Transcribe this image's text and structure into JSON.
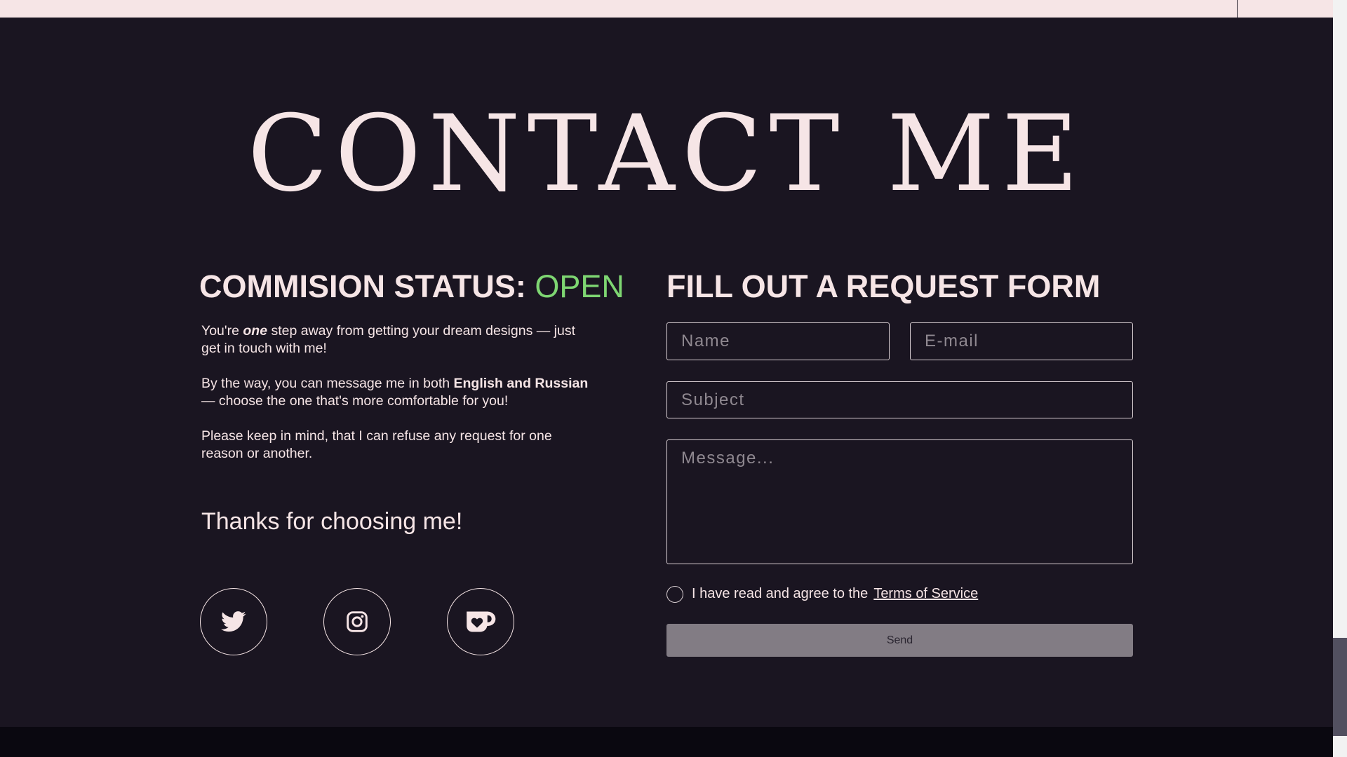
{
  "header": {
    "title": "CONTACT ME"
  },
  "status": {
    "label": "COMMISION STATUS:",
    "value": "OPEN",
    "value_color": "#7ed672"
  },
  "info": {
    "p1_before": "You're ",
    "p1_emphasis": "one",
    "p1_after": " step away from getting your dream designs — just get in touch with me!",
    "p2_before": "By the way, you can message me in both ",
    "p2_strong": "English and Russian",
    "p2_after": " — choose the one that's more comfortable for you!",
    "p3": "Please keep in mind, that I can refuse any request for one reason or another.",
    "thanks": "Thanks for choosing me!"
  },
  "social": [
    {
      "name": "twitter",
      "icon": "twitter-bird-icon"
    },
    {
      "name": "instagram",
      "icon": "instagram-camera-icon"
    },
    {
      "name": "ko-fi",
      "icon": "kofi-cup-heart-icon"
    }
  ],
  "form": {
    "heading": "FILL OUT A REQUEST FORM",
    "name_placeholder": "Name",
    "email_placeholder": "E-mail",
    "subject_placeholder": "Subject",
    "message_placeholder": "Message...",
    "tos_text": "I have read and agree to the",
    "tos_link": "Terms of Service",
    "send_label": "Send"
  },
  "colors": {
    "background": "#1a1521",
    "text": "#f6e5e6",
    "accent_open": "#7ed672",
    "button": "#827c84"
  }
}
